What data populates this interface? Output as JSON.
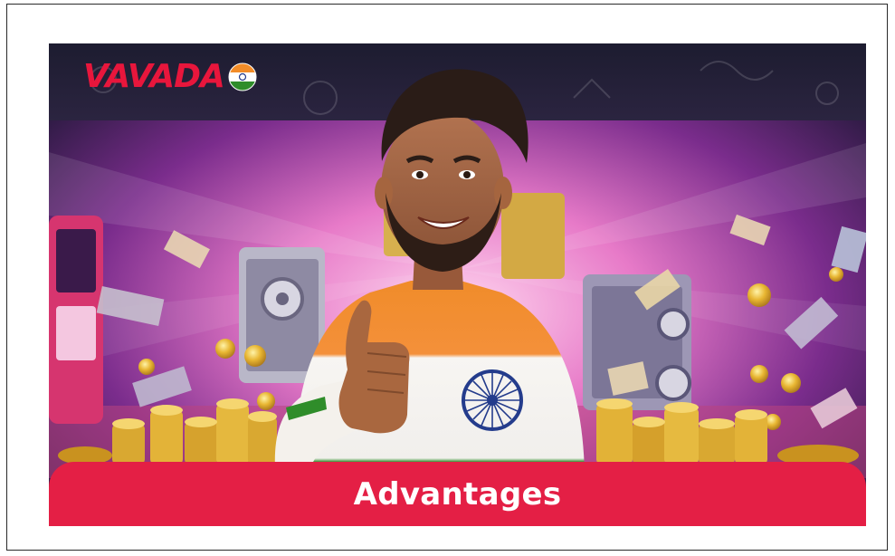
{
  "brand": {
    "name": "VAVADA",
    "accent": "#e8163c",
    "bar_color": "#e41f45",
    "flag": "india-flag-icon"
  },
  "banner": {
    "title": "Advantages"
  }
}
